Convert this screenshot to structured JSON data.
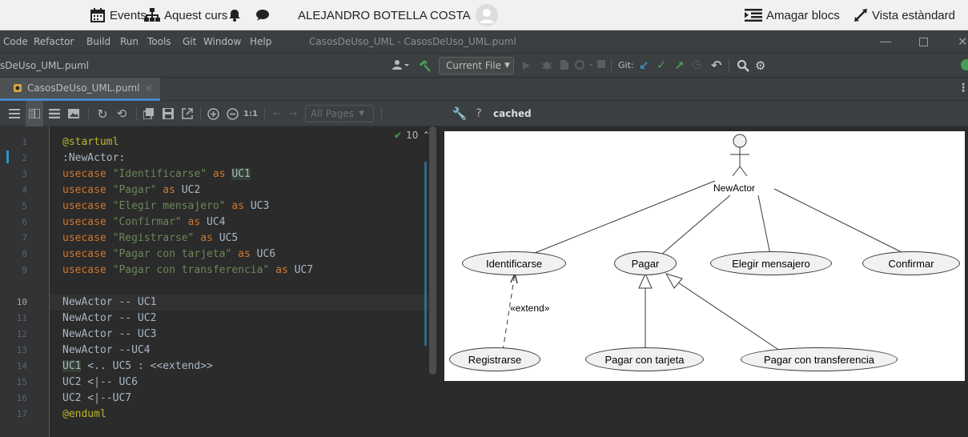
{
  "topbar": {
    "events": "Events",
    "course": "Aquest curs",
    "user_name": "ALEJANDRO BOTELLA COSTA",
    "hide_blocks": "Amagar blocs",
    "standard_view": "Vista estàndard"
  },
  "menubar": {
    "items": [
      "Code",
      "Refactor",
      "Build",
      "Run",
      "Tools",
      "Git",
      "Window",
      "Help"
    ],
    "window_title": "CasosDeUso_UML - CasosDeUso_UML.puml"
  },
  "navbar": {
    "breadcrumb": "sDeUso_UML.puml",
    "run_config": "Current File",
    "git_label": "Git:"
  },
  "tab": {
    "label": "CasosDeUso_UML.puml"
  },
  "toolbar": {
    "zoom_reset": "1:1",
    "pages": "All Pages",
    "help": "?",
    "status": "cached"
  },
  "editor": {
    "inspection_count": "10",
    "line_numbers": [
      "1",
      "2",
      "3",
      "4",
      "5",
      "6",
      "7",
      "8",
      "9",
      "10",
      "11",
      "12",
      "13",
      "14",
      "15",
      "16",
      "17"
    ],
    "lines": {
      "l1": "@startuml",
      "l2": ":NewActor:",
      "l3": [
        "usecase",
        "\"Identificarse\"",
        "as",
        "UC1"
      ],
      "l4": [
        "usecase",
        "\"Pagar\"",
        "as",
        "UC2"
      ],
      "l5": [
        "usecase",
        "\"Elegir mensajero\"",
        "as",
        "UC3"
      ],
      "l6": [
        "usecase",
        "\"Confirmar\"",
        "as",
        "UC4"
      ],
      "l7": [
        "usecase",
        "\"Registrarse\"",
        "as",
        "UC5"
      ],
      "l8": [
        "usecase",
        "\"Pagar con tarjeta\"",
        "as",
        "UC6"
      ],
      "l9": [
        "usecase",
        "\"Pagar con transferencia\"",
        "as",
        "UC7"
      ],
      "l10": "NewActor -- UC1",
      "l11": "NewActor -- UC2",
      "l12": "NewActor -- UC3",
      "l13": "NewActor --UC4",
      "l14a": "UC1",
      "l14b": " <.. UC5 : <<extend>>",
      "l15": "UC2 <|-- UC6",
      "l16": "UC2 <|--UC7",
      "l17": "@enduml"
    }
  },
  "diagram": {
    "actor": "NewActor",
    "usecases": {
      "uc1": "Identificarse",
      "uc2": "Pagar",
      "uc3": "Elegir mensajero",
      "uc4": "Confirmar",
      "uc5": "Registrarse",
      "uc6": "Pagar con tarjeta",
      "uc7": "Pagar con transferencia"
    },
    "extend_label": "«extend»"
  },
  "colors": {
    "keyword": "#cc7832",
    "string": "#6a8759",
    "annotation": "#bbb529",
    "accent": "#4a88c7"
  }
}
